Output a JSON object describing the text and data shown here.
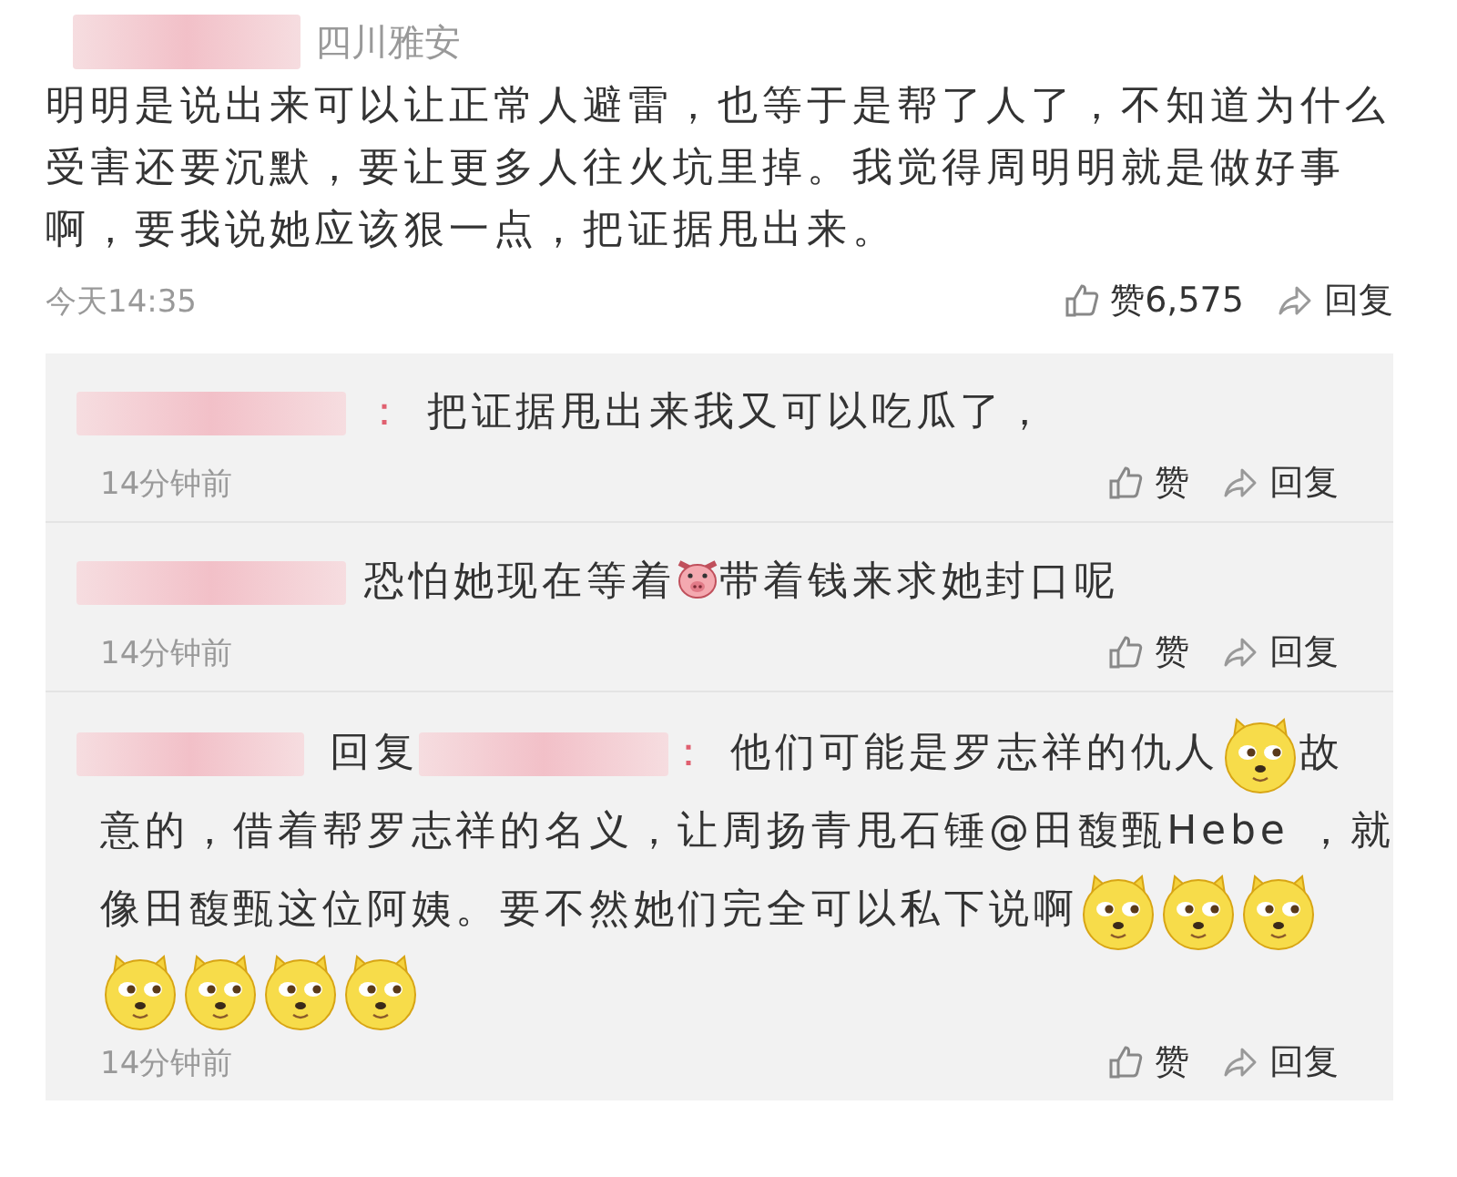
{
  "comment": {
    "location": "四川雅安",
    "text": "明明是说出来可以让正常人避雷，也等于是帮了人了，不知道为什么受害还要沉默，要让更多人往火坑里掉。我觉得周明明就是做好事啊，要我说她应该狠一点，把证据甩出来。",
    "time": "今天14:35",
    "like_label": "赞6,575",
    "reply_label": "回复"
  },
  "replies": [
    {
      "parts": [
        {
          "kind": "redacted"
        },
        {
          "kind": "colon",
          "text": "："
        },
        {
          "kind": "text",
          "text": "把证据甩出来我又可以吃瓜了，"
        }
      ],
      "time": "14分钟前",
      "like_label": "赞",
      "reply_label": "回复"
    },
    {
      "parts": [
        {
          "kind": "redacted"
        },
        {
          "kind": "text",
          "text": "恐怕她现在等着"
        },
        {
          "kind": "pig"
        },
        {
          "kind": "text",
          "text": "带着钱来求她封口呢"
        }
      ],
      "time": "14分钟前",
      "like_label": "赞",
      "reply_label": "回复"
    },
    {
      "parts": [
        {
          "kind": "redacted"
        },
        {
          "kind": "label",
          "text": "回复"
        },
        {
          "kind": "redacted"
        },
        {
          "kind": "colon",
          "text": "："
        },
        {
          "kind": "text",
          "text": "他们可能是罗志祥的仇人"
        },
        {
          "kind": "doge"
        },
        {
          "kind": "text",
          "text": "故"
        },
        {
          "kind": "text",
          "text": "意的，借着帮罗志祥的名义，让周扬青甩石锤@田馥甄Hebe ，就"
        },
        {
          "kind": "text",
          "text": "像田馥甄这位阿姨。要不然她们完全可以私下说啊"
        },
        {
          "kind": "doge"
        },
        {
          "kind": "doge"
        },
        {
          "kind": "doge"
        },
        {
          "kind": "doge"
        },
        {
          "kind": "doge"
        },
        {
          "kind": "doge"
        },
        {
          "kind": "doge"
        }
      ],
      "time": "14分钟前",
      "like_label": "赞",
      "reply_label": "回复"
    }
  ]
}
